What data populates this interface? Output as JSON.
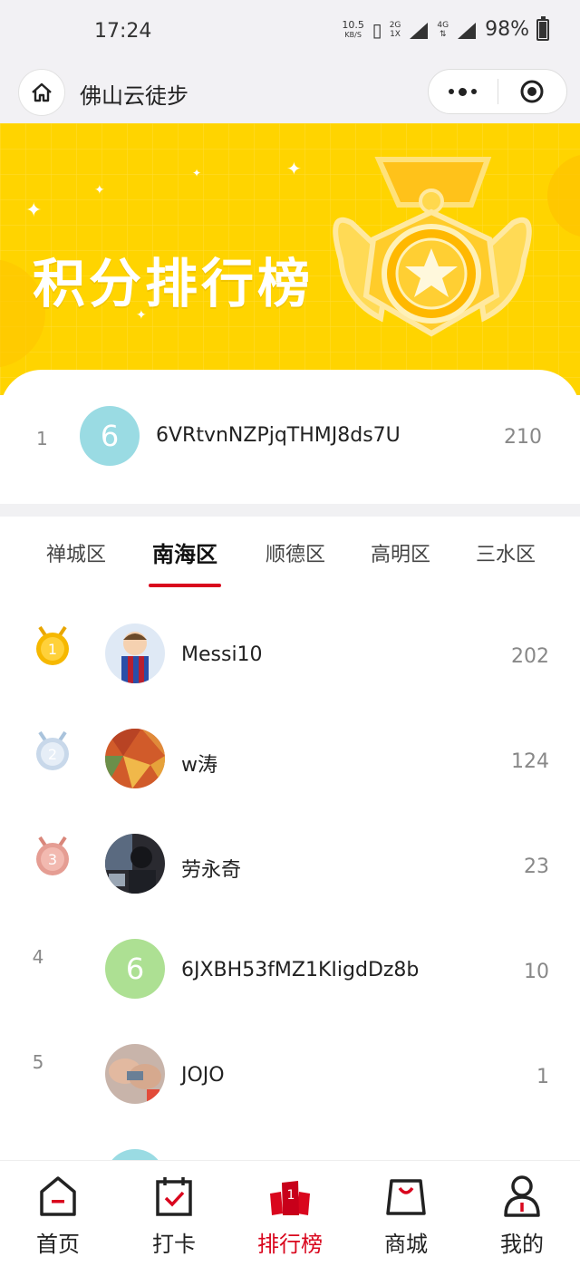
{
  "status_bar": {
    "time": "17:24",
    "net_speed": "10.5",
    "net_speed_unit": "KB/S",
    "net_2g": "2G",
    "net_1x": "1X",
    "net_4g": "4G",
    "battery": "98%"
  },
  "nav": {
    "title": "佛山云徒步"
  },
  "banner": {
    "title": "积分排行榜",
    "bg_color": "#ffd400"
  },
  "my_rank": {
    "rank": "1",
    "avatar_letter": "6",
    "name": "6VRtvnNZPjqTHMJ8ds7U",
    "score": "210"
  },
  "tabs": [
    {
      "label": "禅城区",
      "active": false
    },
    {
      "label": "南海区",
      "active": true
    },
    {
      "label": "顺德区",
      "active": false
    },
    {
      "label": "高明区",
      "active": false
    },
    {
      "label": "三水区",
      "active": false
    }
  ],
  "ranking": [
    {
      "rank": "1",
      "medal": "gold-medal",
      "avatar": "cartoon-messi-avatar",
      "name": "Messi10",
      "score": "202"
    },
    {
      "rank": "2",
      "medal": "silver-medal",
      "avatar": "colorful-polygon-avatar",
      "name": "w涛",
      "score": "124"
    },
    {
      "rank": "3",
      "medal": "bronze-medal",
      "avatar": "photo-avatar",
      "name": "劳永奇",
      "score": "23"
    },
    {
      "rank": "4",
      "avatar_letter": "6",
      "name": "6JXBH53fMZ1KIigdDz8b",
      "score": "10"
    },
    {
      "rank": "5",
      "avatar": "hands-photo-avatar",
      "name": "JOJO",
      "score": "1"
    }
  ],
  "tabbar": [
    {
      "label": "首页",
      "icon": "home-icon",
      "active": false
    },
    {
      "label": "打卡",
      "icon": "calendar-check-icon",
      "active": false
    },
    {
      "label": "排行榜",
      "icon": "podium-icon",
      "active": true
    },
    {
      "label": "商城",
      "icon": "shopping-bag-icon",
      "active": false
    },
    {
      "label": "我的",
      "icon": "person-icon",
      "active": false
    }
  ],
  "colors": {
    "accent": "#d9061d",
    "banner": "#ffd400",
    "avatar_teal": "#9adbe3",
    "avatar_green": "#ade093"
  }
}
